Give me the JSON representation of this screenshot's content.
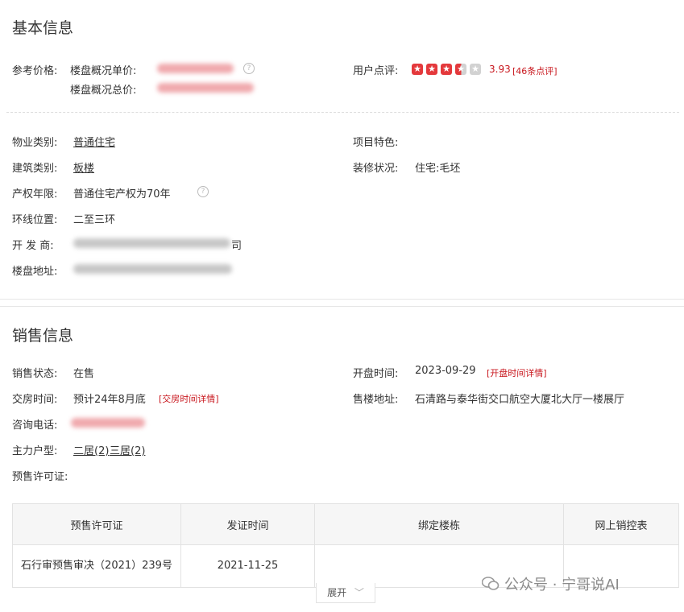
{
  "basic": {
    "title": "基本信息",
    "price_label": "参考价格:",
    "unit_price_label": "楼盘概况单价:",
    "total_price_label": "楼盘概况总价:",
    "rating_label": "用户点评:",
    "rating_value": "3.93",
    "rating_count": "[46条点评]",
    "property_type_label": "物业类别:",
    "property_type": "普通住宅",
    "feature_label": "项目特色:",
    "building_type_label": "建筑类别:",
    "building_type": "板楼",
    "decoration_label": "装修状况:",
    "decoration": "住宅:毛坯",
    "tenure_label": "产权年限:",
    "tenure": "普通住宅产权为70年",
    "ring_label": "环线位置:",
    "ring": "二至三环",
    "developer_label": "开 发 商:",
    "developer_tail": "司",
    "address_label": "楼盘地址:"
  },
  "sales": {
    "title": "销售信息",
    "status_label": "销售状态:",
    "status": "在售",
    "open_label": "开盘时间:",
    "open_date": "2023-09-29",
    "open_detail": "[开盘时间详情]",
    "delivery_label": "交房时间:",
    "delivery": "预计24年8月底",
    "delivery_detail": "[交房时间详情]",
    "office_label": "售楼地址:",
    "office": "石清路与泰华街交口航空大厦北大厅一楼展厅",
    "phone_label": "咨询电话:",
    "layout_label": "主力户型:",
    "layout_1": "二居(2)",
    "layout_2": "三居(2)",
    "permit_label": "预售许可证:"
  },
  "permit_table": {
    "headers": [
      "预售许可证",
      "发证时间",
      "绑定楼栋",
      "网上销控表"
    ],
    "rows": [
      [
        "石行审预售审决（2021）239号",
        "2021-11-25",
        "",
        ""
      ]
    ]
  },
  "expand_label": "展开",
  "watermark": "公众号 · 宁哥说AI",
  "icons": {
    "help": "question-circle-icon",
    "star": "star-icon",
    "chevron": "chevron-down-icon",
    "wechat": "wechat-icon"
  },
  "colors": {
    "accent_red": "#c8161d",
    "star_red": "#e4393c"
  },
  "rating_stars": 3.5
}
